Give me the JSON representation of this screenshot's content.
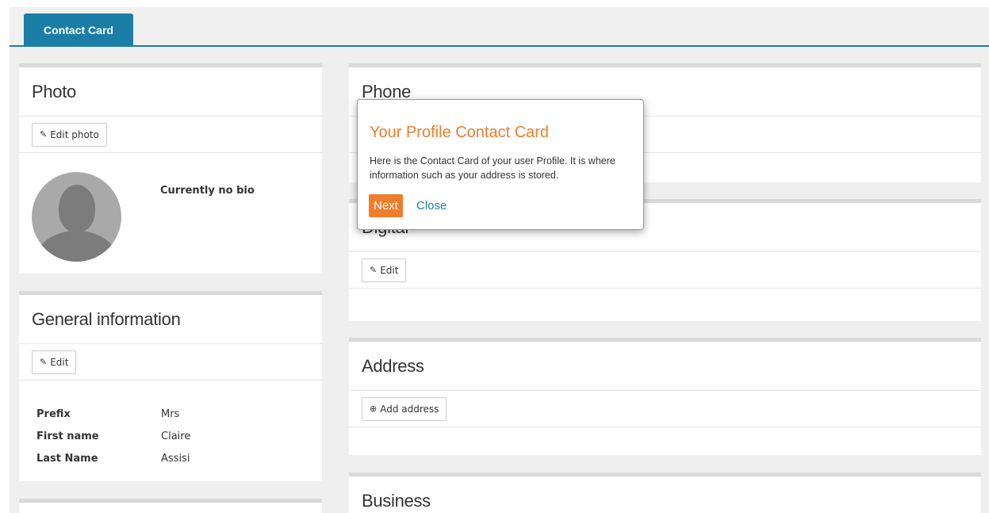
{
  "tabs": {
    "active": "Contact Card"
  },
  "photo": {
    "title": "Photo",
    "edit_label": "Edit photo",
    "bio": "Currently no bio"
  },
  "general": {
    "title": "General information",
    "edit_label": "Edit",
    "fields": [
      {
        "label": "Prefix",
        "value": "Mrs"
      },
      {
        "label": "First name",
        "value": "Claire"
      },
      {
        "label": "Last Name",
        "value": "Assisi"
      }
    ]
  },
  "phone": {
    "title": "Phone"
  },
  "digital": {
    "title": "Digital",
    "edit_label": "Edit"
  },
  "address": {
    "title": "Address",
    "add_label": "Add address"
  },
  "business": {
    "title": "Business"
  },
  "popover": {
    "title": "Your Profile Contact Card",
    "text": "Here is the Contact Card of your user Profile. It is where information such as your address is stored.",
    "next_label": "Next",
    "close_label": "Close"
  },
  "colors": {
    "accent": "#1a7ea7",
    "popover_accent": "#ef7d2b"
  }
}
